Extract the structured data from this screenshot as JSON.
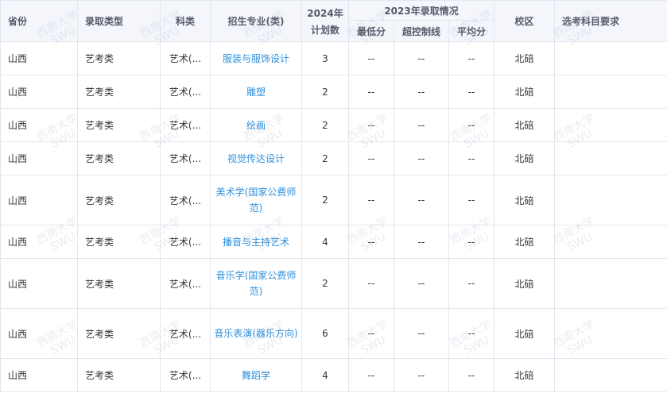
{
  "header": {
    "province": "省份",
    "admission_type": "录取类型",
    "subject": "科类",
    "major": "招生专业(类)",
    "plan_year": "2024年",
    "plan_label": "计划数",
    "prev_group": "2023年录取情况",
    "min_score": "最低分",
    "over_line": "超控制线",
    "avg_score": "平均分",
    "campus": "校区",
    "requirements": "选考科目要求"
  },
  "watermark": {
    "line1": "西南大学",
    "line2": "SWU"
  },
  "rows": [
    {
      "province": "山西",
      "type": "艺考类",
      "subject": "艺术(...",
      "major": "服装与服饰设计",
      "plan": "3",
      "min": "--",
      "over": "--",
      "avg": "--",
      "campus": "北碚",
      "req": ""
    },
    {
      "province": "山西",
      "type": "艺考类",
      "subject": "艺术(...",
      "major": "雕塑",
      "plan": "2",
      "min": "--",
      "over": "--",
      "avg": "--",
      "campus": "北碚",
      "req": ""
    },
    {
      "province": "山西",
      "type": "艺考类",
      "subject": "艺术(...",
      "major": "绘画",
      "plan": "2",
      "min": "--",
      "over": "--",
      "avg": "--",
      "campus": "北碚",
      "req": ""
    },
    {
      "province": "山西",
      "type": "艺考类",
      "subject": "艺术(...",
      "major": "视觉传达设计",
      "plan": "2",
      "min": "--",
      "over": "--",
      "avg": "--",
      "campus": "北碚",
      "req": ""
    },
    {
      "province": "山西",
      "type": "艺考类",
      "subject": "艺术(...",
      "major": "美术学(国家公费师范)",
      "plan": "2",
      "min": "--",
      "over": "--",
      "avg": "--",
      "campus": "北碚",
      "req": ""
    },
    {
      "province": "山西",
      "type": "艺考类",
      "subject": "艺术(...",
      "major": "播音与主持艺术",
      "plan": "4",
      "min": "--",
      "over": "--",
      "avg": "--",
      "campus": "北碚",
      "req": ""
    },
    {
      "province": "山西",
      "type": "艺考类",
      "subject": "艺术(...",
      "major": "音乐学(国家公费师范)",
      "plan": "2",
      "min": "--",
      "over": "--",
      "avg": "--",
      "campus": "北碚",
      "req": ""
    },
    {
      "province": "山西",
      "type": "艺考类",
      "subject": "艺术(...",
      "major": "音乐表演(器乐方向)",
      "plan": "6",
      "min": "--",
      "over": "--",
      "avg": "--",
      "campus": "北碚",
      "req": ""
    },
    {
      "province": "山西",
      "type": "艺考类",
      "subject": "艺术(...",
      "major": "舞蹈学",
      "plan": "4",
      "min": "--",
      "over": "--",
      "avg": "--",
      "campus": "北碚",
      "req": ""
    }
  ]
}
